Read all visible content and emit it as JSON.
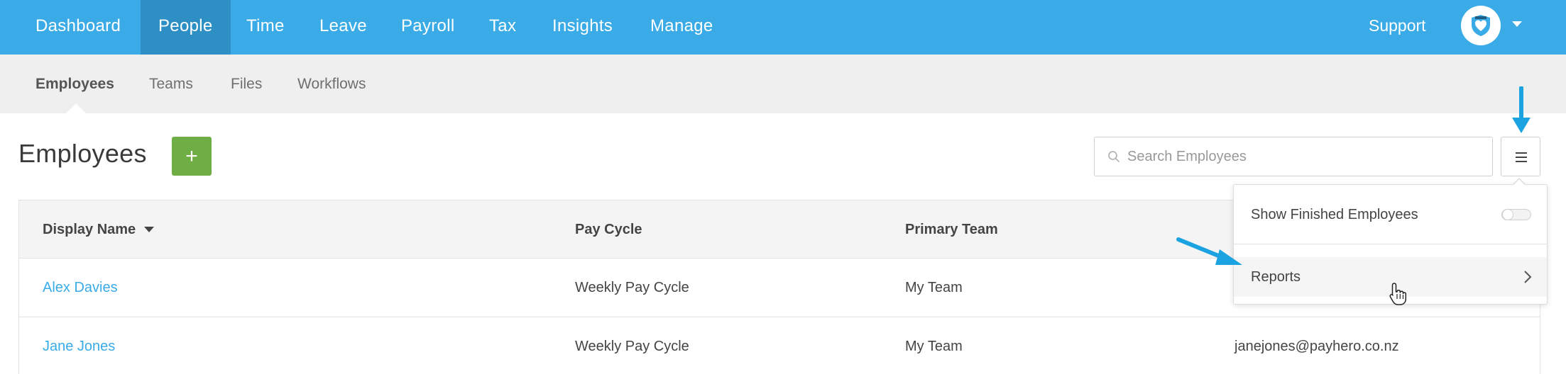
{
  "topnav": {
    "items": [
      {
        "label": "Dashboard",
        "active": false
      },
      {
        "label": "People",
        "active": true
      },
      {
        "label": "Time",
        "active": false
      },
      {
        "label": "Leave",
        "active": false
      },
      {
        "label": "Payroll",
        "active": false
      },
      {
        "label": "Tax",
        "active": false
      },
      {
        "label": "Insights",
        "active": false
      },
      {
        "label": "Manage",
        "active": false
      }
    ],
    "support_label": "Support",
    "bg_color": "#3aabe6",
    "active_color": "#2e8fc4"
  },
  "subnav": {
    "items": [
      {
        "label": "Employees",
        "active": true
      },
      {
        "label": "Teams",
        "active": false
      },
      {
        "label": "Files",
        "active": false
      },
      {
        "label": "Workflows",
        "active": false
      }
    ]
  },
  "page": {
    "title": "Employees",
    "add_label": "+",
    "add_color": "#6fae45"
  },
  "search": {
    "placeholder": "Search Employees",
    "value": ""
  },
  "table": {
    "columns": [
      "Display Name",
      "Pay Cycle",
      "Primary Team",
      ""
    ],
    "sort_column": "Display Name",
    "rows": [
      {
        "name": "Alex Davies",
        "pay_cycle": "Weekly Pay Cycle",
        "team": "My Team",
        "email": ""
      },
      {
        "name": "Jane Jones",
        "pay_cycle": "Weekly Pay Cycle",
        "team": "My Team",
        "email": "janejones@payhero.co.nz"
      }
    ]
  },
  "dropdown": {
    "show_finished_label": "Show Finished Employees",
    "show_finished_on": false,
    "reports_label": "Reports"
  },
  "icons": {
    "avatar": "heart-shield-icon",
    "search": "search-icon",
    "menu": "hamburger-menu-icon",
    "reports_chevron": "chevron-right-icon",
    "cursor": "hand-pointer-icon",
    "annotation": "arrow-icon"
  },
  "annotation_color": "#1aa3e0"
}
